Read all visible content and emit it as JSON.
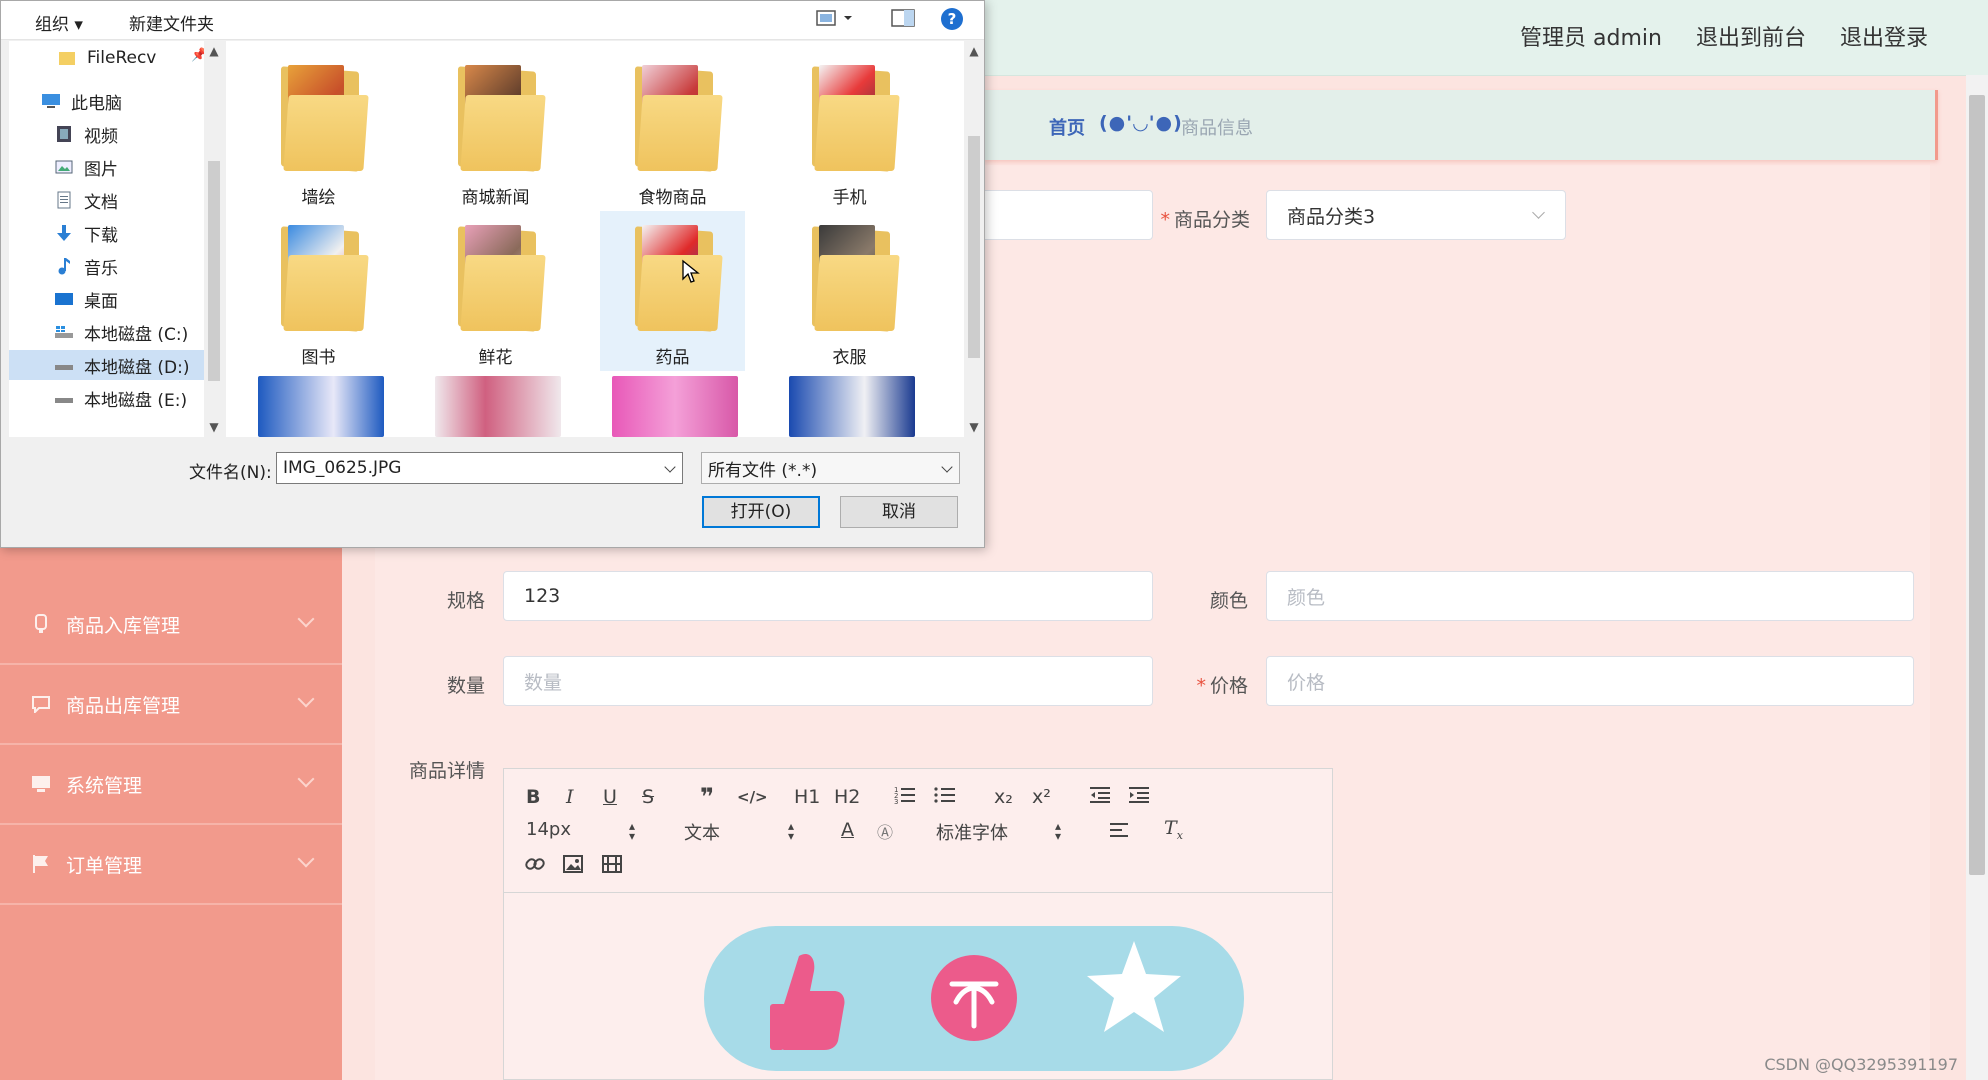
{
  "header": {
    "admin_label": "管理员 admin",
    "to_frontend": "退出到前台",
    "logout": "退出登录"
  },
  "sidebar": {
    "items": [
      {
        "label": "商品入库管理",
        "icon": "inbox-icon"
      },
      {
        "label": "商品出库管理",
        "icon": "chat-icon"
      },
      {
        "label": "系统管理",
        "icon": "monitor-icon"
      },
      {
        "label": "订单管理",
        "icon": "flag-icon"
      }
    ]
  },
  "breadcrumb": {
    "home": "首页",
    "face": "(●'◡'●)",
    "current": "商品信息"
  },
  "form": {
    "category_label": "商品分类",
    "category_value": "商品分类3",
    "spec_label": "规格",
    "spec_value": "123",
    "color_label": "颜色",
    "color_placeholder": "颜色",
    "qty_label": "数量",
    "qty_placeholder": "数量",
    "price_label": "价格",
    "price_placeholder": "价格",
    "detail_label": "商品详情",
    "required_mark": "*"
  },
  "editor": {
    "toolbar_row1": [
      "B",
      "I",
      "U",
      "S",
      "❞",
      "</>",
      "H1",
      "H2",
      "ordered-list",
      "bullet-list",
      "x₂",
      "x²",
      "outdent",
      "indent"
    ],
    "font_size": "14px",
    "header_select": "文本",
    "font_family": "标准字体"
  },
  "dialog": {
    "organize": "组织 ▾",
    "new_folder": "新建文件夹",
    "nav": [
      {
        "label": "FileRecv"
      },
      {
        "label": "此电脑"
      },
      {
        "label": "视频"
      },
      {
        "label": "图片"
      },
      {
        "label": "文档"
      },
      {
        "label": "下载"
      },
      {
        "label": "音乐"
      },
      {
        "label": "桌面"
      },
      {
        "label": "本地磁盘 (C:)"
      },
      {
        "label": "本地磁盘 (D:)"
      },
      {
        "label": "本地磁盘 (E:)"
      }
    ],
    "folders": [
      {
        "name": "墙绘"
      },
      {
        "name": "商城新闻"
      },
      {
        "name": "食物商品"
      },
      {
        "name": "手机"
      },
      {
        "name": "图书"
      },
      {
        "name": "鲜花"
      },
      {
        "name": "药品"
      },
      {
        "name": "衣服"
      }
    ],
    "filename_label": "文件名(N):",
    "filename_value": "IMG_0625.JPG",
    "filetype_value": "所有文件 (*.*)",
    "open_button": "打开(O)",
    "cancel_button": "取消"
  },
  "watermark": "CSDN @QQ3295391197",
  "colors": {
    "sidebar_bg": "#f29a8c",
    "topbar_bg": "#e4f2ec",
    "page_bg": "#fce4e0",
    "accent_blue": "#3d66b8",
    "dialog_default_border": "#0078d7"
  }
}
